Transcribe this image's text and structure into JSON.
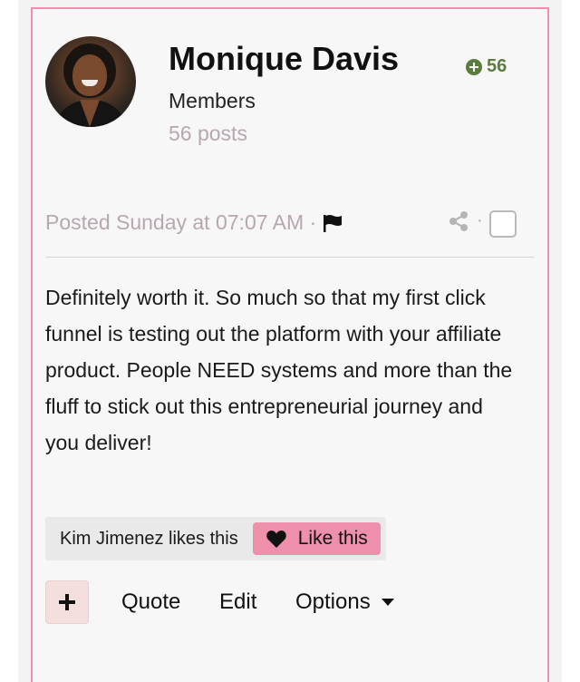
{
  "author": {
    "name": "Monique Davis",
    "reputation": "56",
    "group": "Members",
    "post_count": "56 posts"
  },
  "post": {
    "meta": "Posted Sunday at 07:07 AM ·",
    "share_separator": "·",
    "body": "Definitely worth it. So much so that my first click funnel is testing out the platform with your affiliate product. People NEED systems and more than the fluff to stick out this entrepreneurial journey and you deliver!"
  },
  "reactions": {
    "likers": "Kim Jimenez likes this",
    "like_label": "Like this"
  },
  "actions": {
    "quote": "Quote",
    "edit": "Edit",
    "options": "Options"
  },
  "colors": {
    "accent_pink": "#ee8fac",
    "border_pink": "#ef8fab",
    "reputation_green": "#5a7d3f",
    "muted_text": "#b6a7b1"
  },
  "icons": [
    "reputation-plus-icon",
    "flag-icon",
    "share-icon",
    "checkbox-icon",
    "heart-icon",
    "plus-icon",
    "caret-down-icon"
  ]
}
